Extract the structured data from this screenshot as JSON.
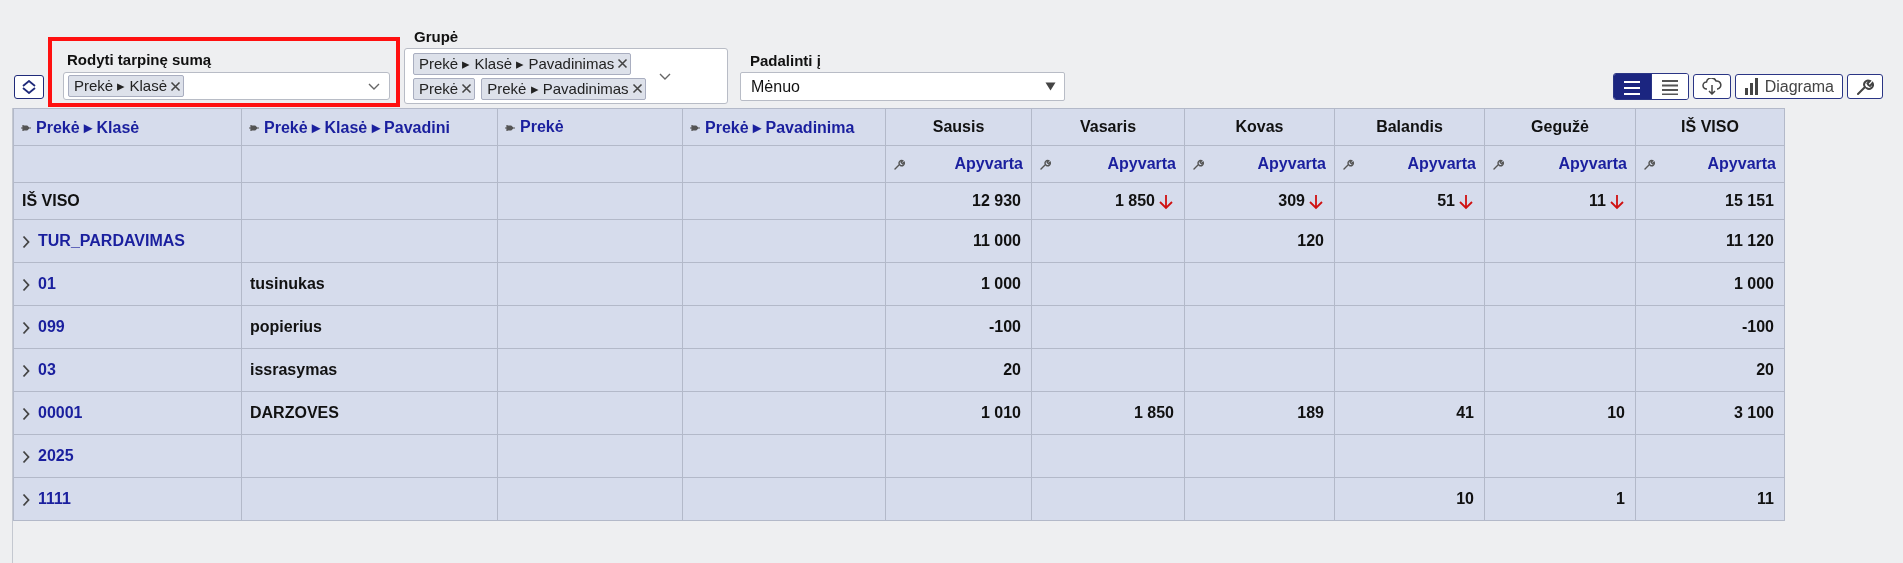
{
  "subtotal_filter": {
    "label": "Rodyti tarpinę sumą",
    "highlighted": true,
    "tags": [
      {
        "text": "Prekė ▸ Klasė"
      }
    ]
  },
  "group_filter": {
    "label": "Grupė",
    "tags": [
      {
        "text": "Prekė ▸ Klasė ▸ Pavadinimas"
      },
      {
        "text": "Prekė"
      },
      {
        "text": "Prekė ▸ Pavadinimas"
      }
    ]
  },
  "split_by": {
    "label": "Padalinti į",
    "value": "Mėnuo"
  },
  "toolbar": {
    "view_buttons": [
      {
        "selected": true
      },
      {
        "selected": false
      }
    ],
    "chart_button": "Diagrama"
  },
  "table": {
    "dimension_columns": [
      {
        "label": "Prekė ▸ Klasė"
      },
      {
        "label": "Prekė ▸ Klasė ▸ Pavadini"
      },
      {
        "label": "Prekė"
      },
      {
        "label": "Prekė ▸ Pavadinima"
      }
    ],
    "value_columns": [
      {
        "label": "Sausis",
        "measure": "Apyvarta"
      },
      {
        "label": "Vasaris",
        "measure": "Apyvarta"
      },
      {
        "label": "Kovas",
        "measure": "Apyvarta"
      },
      {
        "label": "Balandis",
        "measure": "Apyvarta"
      },
      {
        "label": "Gegužė",
        "measure": "Apyvarta"
      },
      {
        "label": "IŠ VISO",
        "measure": "Apyvarta"
      }
    ],
    "total_row": {
      "label": "IŠ VISO",
      "values": [
        {
          "text": "12 930",
          "trend_down": false
        },
        {
          "text": "1 850",
          "trend_down": true
        },
        {
          "text": "309",
          "trend_down": true
        },
        {
          "text": "51",
          "trend_down": true
        },
        {
          "text": "11",
          "trend_down": true
        },
        {
          "text": "15 151",
          "trend_down": false
        }
      ]
    },
    "rows": [
      {
        "code": "TUR_PARDAVIMAS",
        "values": {
          "column_5": "11 000",
          "column_7": "120",
          "column_10": "11 120"
        }
      },
      {
        "code": "01",
        "name": "tusinukas",
        "values": {
          "column_5": "1 000",
          "column_10": "1 000"
        }
      },
      {
        "code": "099",
        "name": "popierius",
        "values": {
          "column_5": "-100",
          "column_10": "-100"
        }
      },
      {
        "code": "03",
        "name": "issrasymas",
        "values": {
          "column_5": "20",
          "column_10": "20"
        }
      },
      {
        "code": "00001",
        "name": "DARZOVES",
        "values": {
          "column_5": "1 010",
          "column_6": "1 850",
          "column_7": "189",
          "column_8": "41",
          "column_9": "10",
          "column_10": "3 100"
        }
      },
      {
        "code": "2025"
      },
      {
        "code": "1111",
        "values": {
          "column_8": "10",
          "column_9": "1",
          "column_10": "11"
        }
      }
    ]
  }
}
